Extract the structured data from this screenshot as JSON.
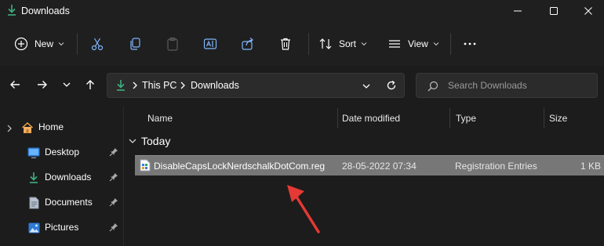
{
  "window": {
    "title": "Downloads"
  },
  "toolbar": {
    "new_label": "New",
    "sort_label": "Sort",
    "view_label": "View"
  },
  "address": {
    "crumbs": [
      "This PC",
      "Downloads"
    ]
  },
  "search": {
    "placeholder": "Search Downloads"
  },
  "sidebar": {
    "items": [
      {
        "label": "Home",
        "icon": "home-icon"
      },
      {
        "label": "Desktop",
        "icon": "desktop-icon",
        "pinned": true
      },
      {
        "label": "Downloads",
        "icon": "download-icon",
        "pinned": true
      },
      {
        "label": "Documents",
        "icon": "document-icon",
        "pinned": true
      },
      {
        "label": "Pictures",
        "icon": "pictures-icon",
        "pinned": true
      }
    ]
  },
  "file_list": {
    "columns": [
      "Name",
      "Date modified",
      "Type",
      "Size"
    ],
    "group_label": "Today",
    "rows": [
      {
        "name": "DisableCapsLockNerdschalkDotCom.reg",
        "date_modified": "28-05-2022 07:34",
        "type": "Registration Entries",
        "size": "1 KB",
        "selected": true
      }
    ]
  },
  "colors": {
    "accent_green": "#3fb07f",
    "annotation_red": "#e53935",
    "selection_bg": "#777777"
  }
}
